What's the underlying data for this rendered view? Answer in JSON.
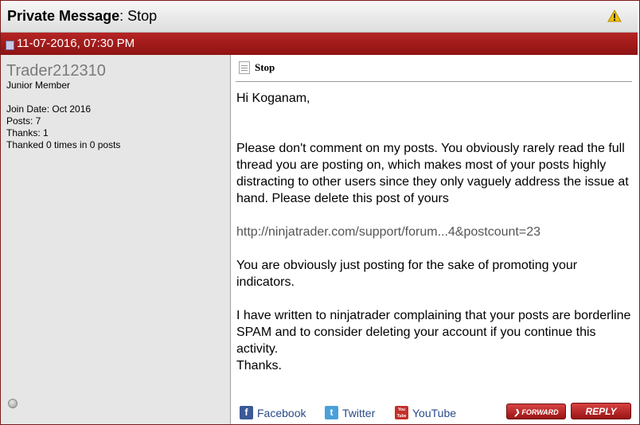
{
  "header": {
    "title_bold": "Private Message",
    "title_rest": ": Stop",
    "warning_icon": "warning-icon"
  },
  "post": {
    "date": "11-07-2016, 07:30 PM",
    "subject": "Stop",
    "body": {
      "greeting": "Hi Koganam,",
      "paragraph1": "Please don't comment on my posts. You obviously rarely read the full thread you are posting on, which makes most of your posts highly distracting to other users since they only vaguely address the issue at hand. Please delete this post of yours",
      "link": "http://ninjatrader.com/support/forum...4&postcount=23",
      "paragraph2": "You are obviously just posting for the sake of promoting your indicators.",
      "paragraph3": "I have written to ninjatrader complaining that your posts are borderline SPAM and to consider deleting your account if you continue this activity.",
      "closing": "Thanks."
    }
  },
  "user": {
    "name": "Trader212310",
    "title": "Junior Member",
    "join_date": "Join Date: Oct 2016",
    "posts": "Posts: 7",
    "thanks": "Thanks: 1",
    "thanked": "Thanked 0 times in 0 posts"
  },
  "social": {
    "facebook": "Facebook",
    "twitter": "Twitter",
    "youtube": "YouTube",
    "youtube_icon_text": "You Tube"
  },
  "buttons": {
    "forward": "❯ FORWARD",
    "reply": "REPLY"
  },
  "colors": {
    "accent": "#a01a1a",
    "link": "#2a4a8a"
  }
}
